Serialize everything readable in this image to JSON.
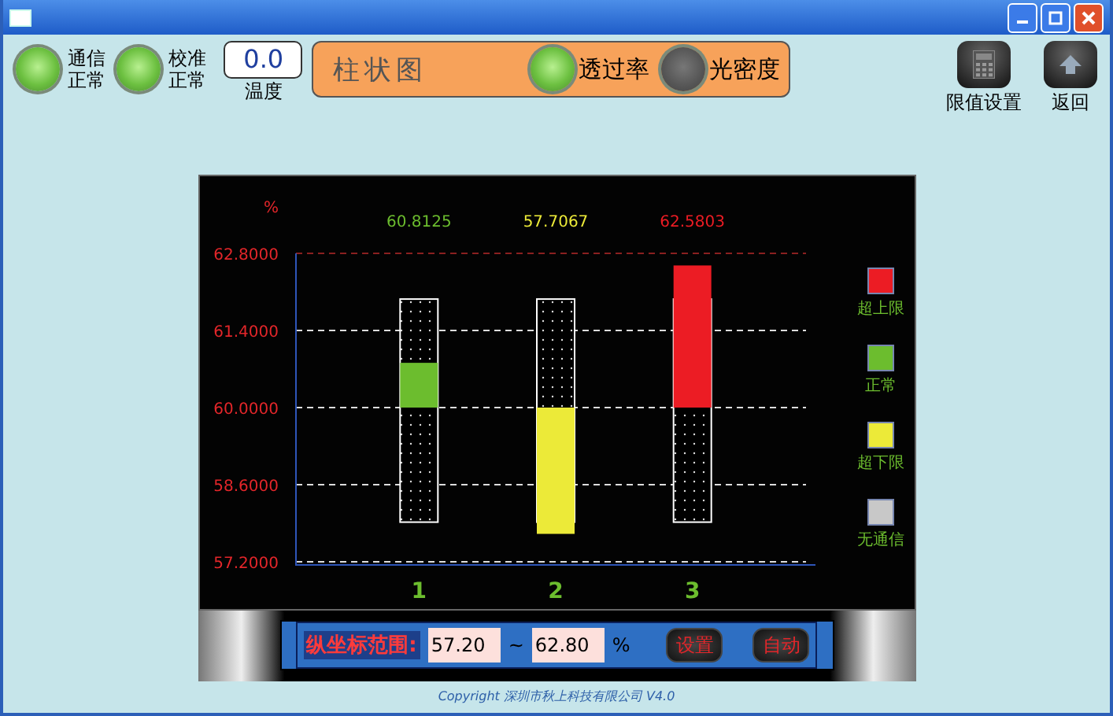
{
  "status": [
    {
      "label": "通信正常",
      "on": true
    },
    {
      "label": "校准正常",
      "on": true
    }
  ],
  "temperature": {
    "value": "0.0",
    "label": "温度"
  },
  "mode_panel": {
    "title": "柱状图",
    "options": [
      {
        "label": "透过率",
        "selected": true
      },
      {
        "label": "光密度",
        "selected": false
      }
    ]
  },
  "toolbar": [
    {
      "label": "限值设置",
      "kind": "calculator"
    },
    {
      "label": "返回",
      "kind": "up"
    }
  ],
  "chart": {
    "unit": "%",
    "y_axis": [
      "62.8000",
      "61.4000",
      "60.0000",
      "58.6000",
      "57.2000"
    ],
    "columns": [
      {
        "label": "1",
        "reading": "60.8125",
        "color": "#6cbd2e"
      },
      {
        "label": "2",
        "reading": "57.7067",
        "color": "#ecea38"
      },
      {
        "label": "3",
        "reading": "62.5803",
        "color": "#ec1c24"
      }
    ],
    "legend": [
      {
        "label": "超上限",
        "color": "#ec1c24"
      },
      {
        "label": "正常",
        "color": "#6cbd2e"
      },
      {
        "label": "超下限",
        "color": "#ecea38"
      },
      {
        "label": "无通信",
        "color": "#c8c8c8"
      }
    ]
  },
  "range": {
    "label": "纵坐标范围:",
    "min": "57.20",
    "separator": "~",
    "max": "62.80",
    "unit": "%",
    "buttons": [
      "设置",
      "自动"
    ]
  },
  "copyright": "Copyright 深圳市秋上科技有限公司 V4.0"
}
